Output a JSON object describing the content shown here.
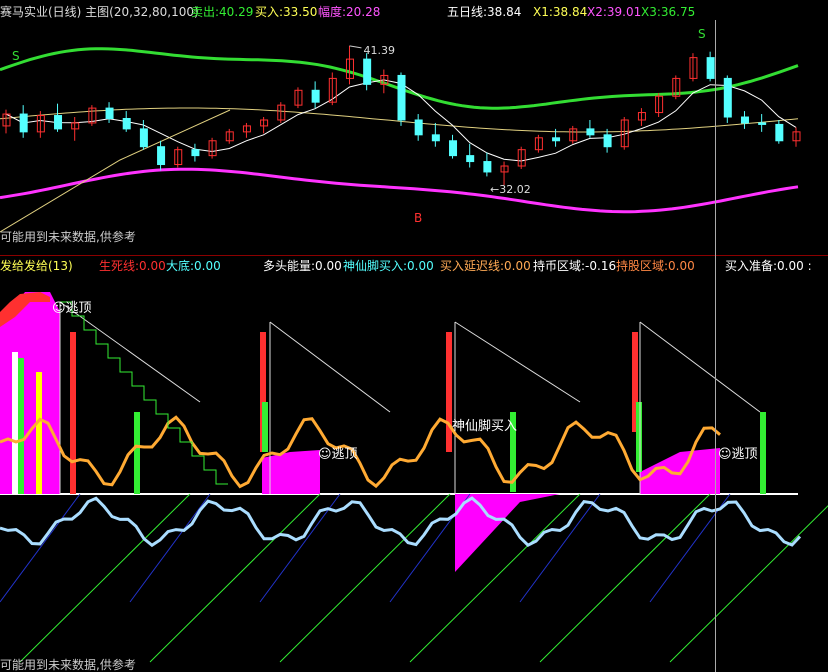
{
  "colors": {
    "background": "#000000",
    "up": "#ff3030",
    "down": "#54ffff",
    "neutral": "#ffff00",
    "upper_band": "#33dd33",
    "lower_band": "#ff33ff",
    "mid_line": "#e0d080",
    "ma5": "#ffffff",
    "signal": "#ffaa33",
    "white": "#ffffff",
    "red_label": "#ff3030",
    "green_label": "#33ee33",
    "cyan_label": "#54ffff",
    "orange_label": "#ffaa55",
    "magenta": "#ff00ff"
  },
  "top_header": {
    "title": "赛马实业(日线) 主图(20,32,80,100)",
    "sell": "卖出:40.29",
    "buy": "买入:33.50",
    "amp": "幅度:20.28",
    "ma_label": "五日线:38.84",
    "x1": "X1:38.84",
    "x2": "X2:39.01",
    "x3": "X3:36.75"
  },
  "bottom_header": {
    "name": "发给发给(13)",
    "life": "生死线:0.00",
    "bottom": "大底:0.00",
    "multi": "多头能量:0.00",
    "shenxian": "神仙脚买入:0.00",
    "delay": "买入延迟线:0.00",
    "hold": "持币区域:-0.16",
    "stock": "持股区域:0.00",
    "prep": "买入准备:0.00 :"
  },
  "notes": {
    "top": "可能用到未来数据,供参考",
    "bottom": "可能用到未来数据,供参考"
  },
  "annotations": {
    "high": "41.39",
    "low": "32.02",
    "s": "S",
    "b": "B",
    "escape": "逃顶",
    "shenxian_label": "神仙脚买入"
  },
  "chart_data": [
    {
      "type": "candlestick",
      "title": "赛马实业(日线) 主图(20,32,80,100)",
      "ylim": [
        30.0,
        43.0
      ],
      "candles": [
        {
          "o": 36.0,
          "h": 37.1,
          "l": 35.5,
          "c": 36.8
        },
        {
          "o": 36.8,
          "h": 37.4,
          "l": 35.2,
          "c": 35.6
        },
        {
          "o": 35.6,
          "h": 37.0,
          "l": 35.2,
          "c": 36.7
        },
        {
          "o": 36.7,
          "h": 37.5,
          "l": 35.6,
          "c": 35.8
        },
        {
          "o": 35.8,
          "h": 36.6,
          "l": 35.0,
          "c": 36.2
        },
        {
          "o": 36.2,
          "h": 37.4,
          "l": 36.0,
          "c": 37.2
        },
        {
          "o": 37.2,
          "h": 37.6,
          "l": 36.2,
          "c": 36.5
        },
        {
          "o": 36.5,
          "h": 37.0,
          "l": 35.6,
          "c": 35.8
        },
        {
          "o": 35.8,
          "h": 36.4,
          "l": 34.4,
          "c": 34.6
        },
        {
          "o": 34.6,
          "h": 35.0,
          "l": 33.0,
          "c": 33.4
        },
        {
          "o": 33.4,
          "h": 34.6,
          "l": 33.2,
          "c": 34.4
        },
        {
          "o": 34.4,
          "h": 34.8,
          "l": 33.6,
          "c": 34.0
        },
        {
          "o": 34.0,
          "h": 35.2,
          "l": 33.8,
          "c": 35.0
        },
        {
          "o": 35.0,
          "h": 35.8,
          "l": 34.8,
          "c": 35.6
        },
        {
          "o": 35.6,
          "h": 36.2,
          "l": 35.2,
          "c": 36.0
        },
        {
          "o": 36.0,
          "h": 36.6,
          "l": 35.5,
          "c": 36.4
        },
        {
          "o": 36.4,
          "h": 37.6,
          "l": 36.2,
          "c": 37.4
        },
        {
          "o": 37.4,
          "h": 38.6,
          "l": 37.2,
          "c": 38.4
        },
        {
          "o": 38.4,
          "h": 39.0,
          "l": 37.2,
          "c": 37.6
        },
        {
          "o": 37.6,
          "h": 39.6,
          "l": 37.4,
          "c": 39.2
        },
        {
          "o": 39.2,
          "h": 41.39,
          "l": 38.8,
          "c": 40.5
        },
        {
          "o": 40.5,
          "h": 40.9,
          "l": 38.4,
          "c": 38.8
        },
        {
          "o": 38.8,
          "h": 39.8,
          "l": 38.2,
          "c": 39.4
        },
        {
          "o": 39.4,
          "h": 39.6,
          "l": 36.0,
          "c": 36.4
        },
        {
          "o": 36.4,
          "h": 36.8,
          "l": 35.0,
          "c": 35.4
        },
        {
          "o": 35.4,
          "h": 36.2,
          "l": 34.6,
          "c": 35.0
        },
        {
          "o": 35.0,
          "h": 35.4,
          "l": 33.8,
          "c": 34.0
        },
        {
          "o": 34.0,
          "h": 34.8,
          "l": 33.2,
          "c": 33.6
        },
        {
          "o": 33.6,
          "h": 34.2,
          "l": 32.6,
          "c": 32.9
        },
        {
          "o": 32.9,
          "h": 33.6,
          "l": 32.02,
          "c": 33.3
        },
        {
          "o": 33.3,
          "h": 34.6,
          "l": 33.1,
          "c": 34.4
        },
        {
          "o": 34.4,
          "h": 35.4,
          "l": 34.2,
          "c": 35.2
        },
        {
          "o": 35.2,
          "h": 35.8,
          "l": 34.6,
          "c": 35.0
        },
        {
          "o": 35.0,
          "h": 36.0,
          "l": 34.8,
          "c": 35.8
        },
        {
          "o": 35.8,
          "h": 36.4,
          "l": 35.2,
          "c": 35.4
        },
        {
          "o": 35.4,
          "h": 35.8,
          "l": 34.2,
          "c": 34.6
        },
        {
          "o": 34.6,
          "h": 36.6,
          "l": 34.4,
          "c": 36.4
        },
        {
          "o": 36.4,
          "h": 37.2,
          "l": 36.0,
          "c": 36.9
        },
        {
          "o": 36.9,
          "h": 38.2,
          "l": 36.6,
          "c": 38.0
        },
        {
          "o": 38.0,
          "h": 39.4,
          "l": 37.8,
          "c": 39.2
        },
        {
          "o": 39.2,
          "h": 40.9,
          "l": 39.0,
          "c": 40.6
        },
        {
          "o": 40.6,
          "h": 41.0,
          "l": 39.0,
          "c": 39.2
        },
        {
          "o": 39.2,
          "h": 39.4,
          "l": 36.2,
          "c": 36.6
        },
        {
          "o": 36.6,
          "h": 37.0,
          "l": 35.8,
          "c": 36.2
        },
        {
          "o": 36.2,
          "h": 36.8,
          "l": 35.6,
          "c": 36.1
        },
        {
          "o": 36.1,
          "h": 36.4,
          "l": 34.8,
          "c": 35.0
        },
        {
          "o": 35.0,
          "h": 35.9,
          "l": 34.6,
          "c": 35.6
        }
      ],
      "ma_labels": [
        "五日线:38.84",
        "X1:38.84",
        "X2:39.01",
        "X3:36.75"
      ]
    },
    {
      "type": "indicator",
      "title": "发给发给(13)",
      "series_names": [
        "生死线",
        "大底",
        "多头能量",
        "神仙脚买入",
        "买入延迟线",
        "持币区域",
        "持股区域",
        "买入准备"
      ],
      "series_values": [
        0.0,
        0.0,
        0.0,
        0.0,
        0.0,
        -0.16,
        0.0,
        0.0
      ],
      "ylim": [
        -1.0,
        1.0
      ]
    }
  ]
}
